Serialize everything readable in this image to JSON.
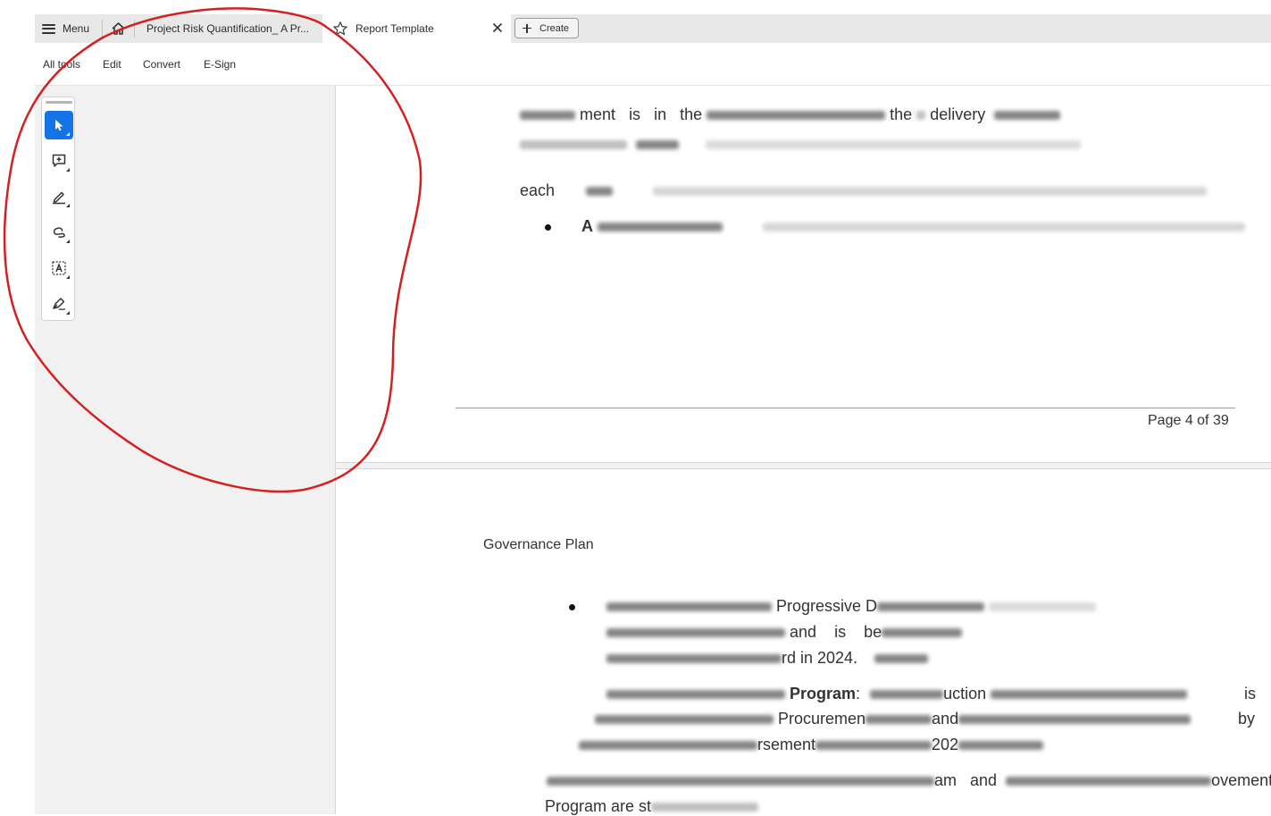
{
  "tabbar": {
    "menu_label": "Menu",
    "tab1_label": "Project Risk Quantification_ A Pr...",
    "active_tab_label": "Report Template",
    "create_label": "Create"
  },
  "menubar": {
    "items": [
      "All tools",
      "Edit",
      "Convert",
      "E-Sign"
    ]
  },
  "tools": [
    "select-tool",
    "add-comment-tool",
    "highlight-tool",
    "draw-freehand-tool",
    "add-text-tool",
    "fill-and-sign-tool"
  ],
  "page4": {
    "line1_words": [
      "ment",
      "is",
      "in",
      "the",
      "the",
      "delivery"
    ],
    "line2_start": "each",
    "bullet1_start": "A",
    "page_number": "Page 4 of 39"
  },
  "page5": {
    "heading": "Governance Plan",
    "b1_line1": "Progressive D",
    "b1_line2_a": "and",
    "b1_line2_b": "is",
    "b1_line2_c": "be",
    "b1_line3": "rd in 2024.",
    "b2_bold": "Program",
    "b2_colon": ":",
    "b2_mid": "uction",
    "b2_end": "is",
    "b2_line2_a": "Procuremen",
    "b2_line2_b": "and",
    "b2_line2_c": "by",
    "b2_line3_a": "rsement",
    "b2_line3_b": "202",
    "p_line1_a": "am",
    "p_line1_b": "and",
    "p_line1_c": "ovement",
    "p_line2": "Program are st"
  },
  "annotation_color": "#d42020",
  "accent_color": "#1473e6"
}
